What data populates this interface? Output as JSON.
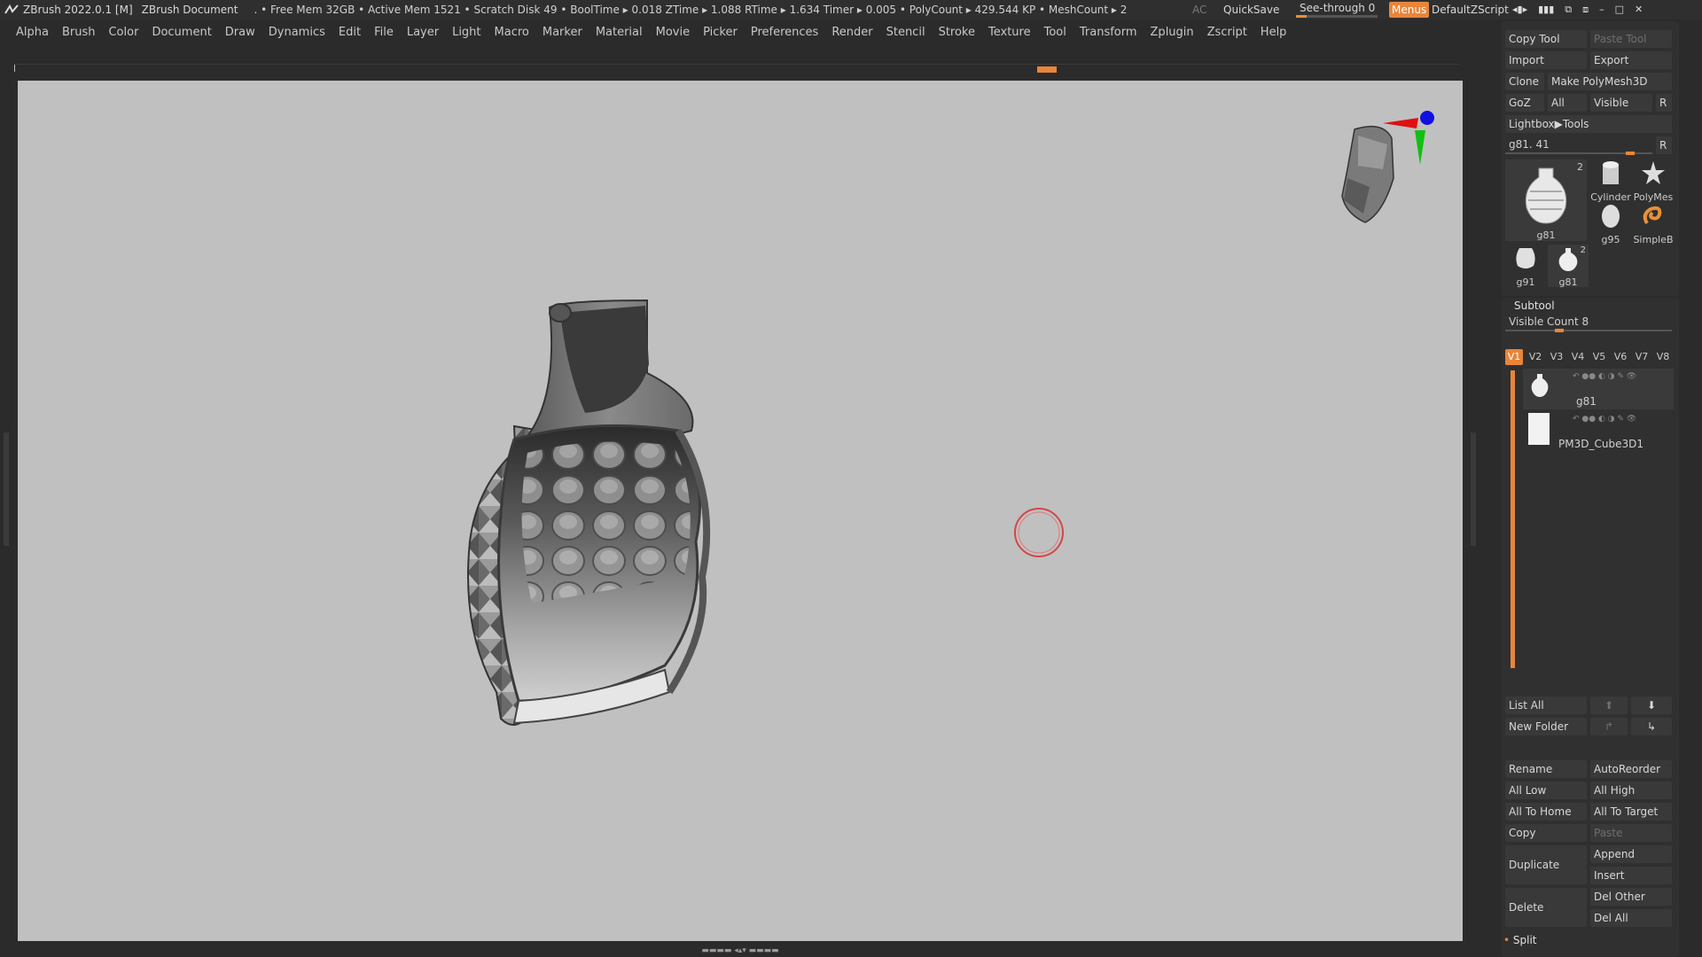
{
  "titlebar": {
    "app": "ZBrush 2022.0.1 [M]",
    "document": "ZBrush Document",
    "stats": ". • Free Mem 32GB • Active Mem 1521 • Scratch Disk 49 • BoolTime ▸ 0.018 ZTime ▸ 1.088 RTime ▸ 1.634 Timer ▸ 0.005 • PolyCount ▸ 429.544 KP  • MeshCount ▸ 2",
    "ac": "AC",
    "quicksave": "QuickSave",
    "see_through": "See-through   0",
    "menus": "Menus",
    "default_zscript": "DefaultZScript"
  },
  "menubar": [
    "Alpha",
    "Brush",
    "Color",
    "Document",
    "Draw",
    "Dynamics",
    "Edit",
    "File",
    "Layer",
    "Light",
    "Macro",
    "Marker",
    "Material",
    "Movie",
    "Picker",
    "Preferences",
    "Render",
    "Stencil",
    "Stroke",
    "Texture",
    "Tool",
    "Transform",
    "Zplugin",
    "Zscript",
    "Help"
  ],
  "tool_panel": {
    "copy_tool": "Copy Tool",
    "paste_tool": "Paste Tool",
    "import": "Import",
    "export": "Export",
    "clone": "Clone",
    "make_polymesh": "Make PolyMesh3D",
    "goz": "GoZ",
    "all": "All",
    "visible": "Visible",
    "r": "R",
    "lightbox_tools": "Lightbox▶Tools",
    "slider_label": "g81. 41",
    "slider_r": "R",
    "thumbs": [
      {
        "label": "g81",
        "badge": "2"
      },
      {
        "label": "Cylinder"
      },
      {
        "label": "PolyMes"
      },
      {
        "label": "g95"
      },
      {
        "label": "SimpleB"
      },
      {
        "label": "g91"
      },
      {
        "label": "g81",
        "badge": "2"
      }
    ]
  },
  "subtool": {
    "title": "Subtool",
    "visible_count": "Visible Count 8",
    "vtabs": [
      "V1",
      "V2",
      "V3",
      "V4",
      "V5",
      "V6",
      "V7",
      "V8"
    ],
    "items": [
      {
        "name": "g81"
      },
      {
        "name": "PM3D_Cube3D1"
      }
    ],
    "list_all": "List All",
    "new_folder": "New Folder",
    "rename": "Rename",
    "auto_reorder": "AutoReorder",
    "all_low": "All Low",
    "all_high": "All High",
    "all_to_home": "All To Home",
    "all_to_target": "All To Target",
    "copy": "Copy",
    "paste": "Paste",
    "duplicate": "Duplicate",
    "append": "Append",
    "insert": "Insert",
    "delete": "Delete",
    "del_other": "Del Other",
    "del_all": "Del All",
    "split": "Split"
  },
  "colors": {
    "accent": "#e8853a",
    "viewport_bg": "#c0c0c0",
    "panel_bg": "#2b2b2b"
  }
}
